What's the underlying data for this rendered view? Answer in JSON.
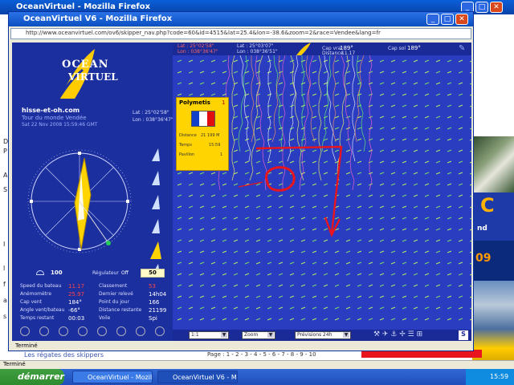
{
  "outer_window": {
    "title": "OceanVirtuel - Mozilla Firefox",
    "left_strip_letters": [
      "D",
      "P",
      "A",
      "S",
      "I",
      "l",
      "f",
      "a",
      "s"
    ],
    "status": "Terminé",
    "tagline": "Les régates des skippers",
    "pages_text": "Page : 1 - 2 - 3 - 4 - 5 - 6 - 7 - 8 - 9 - 10",
    "right_text": "nd",
    "right_number": "09"
  },
  "popup": {
    "title": "OceanVirtuel V6 - Mozilla Firefox",
    "url": "http://www.oceanvirtuel.com/ov6/skipper_nav.php?code=60&id=4515&lat=25.4&lon=-38.6&zoom=2&race=Vendee&lang=fr",
    "status": "Terminé"
  },
  "app": {
    "logo_line1": "OCEAN",
    "logo_line2": "VIRTUEL",
    "skipper": "hisse-et-oh.com",
    "race": "Tour du monde Vendée",
    "date": "Sat 22 Nov 2008 15:59:46 GMT",
    "lat_label": "Lat : 25°02'58\"",
    "lon_label": "Lon : 038°36'47\"",
    "left_input": "100",
    "regulateur_label": "Régulateur",
    "regulateur_state": "Off",
    "regulateur_value": "50",
    "stats_left": [
      {
        "label": "Speed du bateau",
        "value": "11.17"
      },
      {
        "label": "Anémomètre",
        "value": "25.97"
      },
      {
        "label": "Cap vent",
        "value": "184°"
      },
      {
        "label": "Angle vent/bateau",
        "value": "-66°"
      },
      {
        "label": "Temps restant",
        "value": "00:03"
      }
    ],
    "stats_right": [
      {
        "label": "Classement",
        "value": "53"
      },
      {
        "label": "Dernier relevé",
        "value": "14h04"
      },
      {
        "label": "Point du jour",
        "value": "166"
      },
      {
        "label": "Distance restante",
        "value": "21199"
      },
      {
        "label": "Voile",
        "value": "Spi"
      }
    ],
    "top_lat": "Lat : 25°02'58\"",
    "top_lon": "Lon : 038°36'47\"",
    "top_lat2": "Lat : 25°03'07\"",
    "top_lon2": "Lon : 038°36'51\"",
    "cap_label": "Cap vrai",
    "cap_value": "189°",
    "cap_sol_label": "Cap sol",
    "cap_sol_value": "189°",
    "distance_label": "Distance",
    "distance_value": "11.17",
    "boat_card": {
      "name": "Polymetis",
      "rank": "1",
      "distance_label": "Distance",
      "distance_value": "21 199 M",
      "time_label": "Temps",
      "time_value": "15:59",
      "flag_label": "Pavillon",
      "flag_value": "1"
    },
    "select1": "1:1",
    "select2": "Zoom",
    "select3": "Prévisions 24h"
  },
  "taskbar": {
    "start": "démarrer",
    "tasks": [
      "OceanVirtuel - Mozilla...",
      "OceanVirtuel V6 - M..."
    ],
    "clock": "15:59"
  },
  "colors": {
    "app_bg": "#1b2faa",
    "map_bg": "#2a3cc0",
    "card": "#ffd400",
    "annotation": "#e8141e"
  }
}
